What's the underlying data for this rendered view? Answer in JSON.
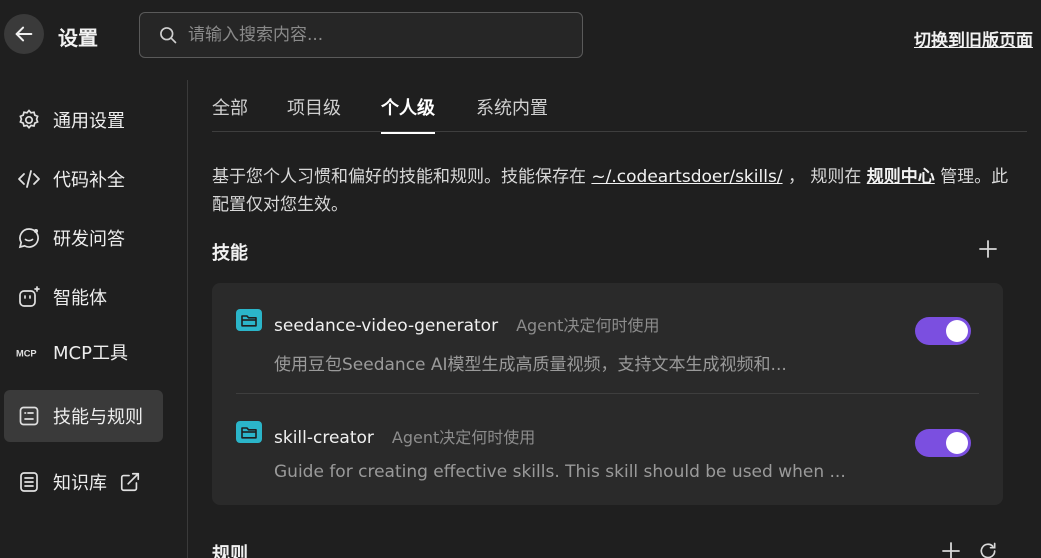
{
  "header": {
    "title": "设置",
    "search_placeholder": "请输入搜索内容...",
    "switch_old_label": "切换到旧版页面"
  },
  "sidebar": {
    "items": [
      {
        "label": "通用设置",
        "icon": "gear-icon"
      },
      {
        "label": "代码补全",
        "icon": "code-icon"
      },
      {
        "label": "研发问答",
        "icon": "chat-icon"
      },
      {
        "label": "智能体",
        "icon": "agent-icon"
      },
      {
        "label": "MCP工具",
        "icon": "mcp-icon"
      },
      {
        "label": "技能与规则",
        "icon": "skills-icon",
        "active": true
      },
      {
        "label": "知识库",
        "icon": "knowledge-icon",
        "external_icon": "external-link-icon"
      }
    ]
  },
  "tabs": [
    {
      "label": "全部"
    },
    {
      "label": "项目级"
    },
    {
      "label": "个人级",
      "active": true
    },
    {
      "label": "系统内置"
    }
  ],
  "description": {
    "part1": "基于您个人习惯和偏好的技能和规则。技能保存在 ",
    "skills_path": "~/.codeartsdoer/skills/",
    "part2": " ， 规则在 ",
    "rules_center": "规则中心",
    "part3": " 管理。此配置仅对您生效。"
  },
  "skills_section": {
    "title": "技能",
    "items": [
      {
        "name": "seedance-video-generator",
        "mode": "Agent决定何时使用",
        "description": "使用豆包Seedance AI模型生成高质量视频，支持文本生成视频和...",
        "enabled": true
      },
      {
        "name": "skill-creator",
        "mode": "Agent决定何时使用",
        "description": "Guide for creating effective skills. This skill should be used when ...",
        "enabled": true
      }
    ]
  },
  "rules_section": {
    "title": "规则"
  },
  "colors": {
    "background": "#1f1f1f",
    "card": "#2a2a2a",
    "toggle_on": "#7b4fe0",
    "skill_icon": "#2bb5c9"
  }
}
